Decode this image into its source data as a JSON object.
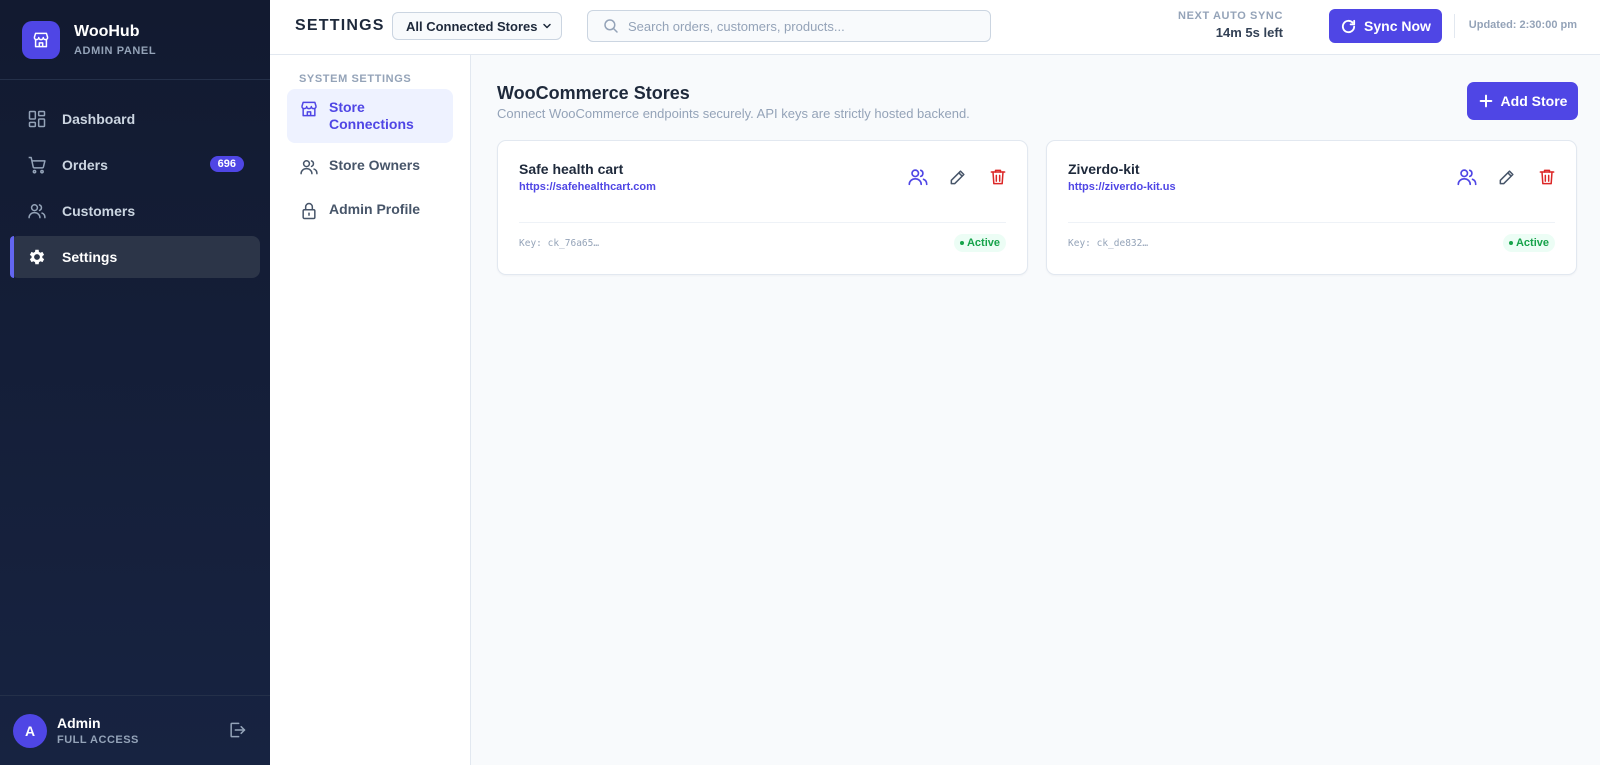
{
  "brand": {
    "name": "WooHub",
    "subtitle": "ADMIN PANEL",
    "logo_icon": "storefront-icon",
    "accent": "#4f46e5"
  },
  "nav": {
    "items": [
      {
        "label": "Dashboard",
        "icon": "dashboard-icon"
      },
      {
        "label": "Orders",
        "icon": "cart-icon",
        "badge": "696"
      },
      {
        "label": "Customers",
        "icon": "users-icon"
      },
      {
        "label": "Settings",
        "icon": "gear-icon",
        "active": true
      }
    ]
  },
  "user": {
    "initial": "A",
    "name": "Admin",
    "role": "FULL ACCESS"
  },
  "header": {
    "title": "SETTINGS",
    "store_select": "All Connected Stores",
    "search_placeholder": "Search orders, customers, products...",
    "sync_label": "NEXT AUTO SYNC",
    "sync_time": "14m 5s left",
    "sync_button": "Sync Now",
    "updated": "Updated: 2:30:00 pm"
  },
  "subnav": {
    "title": "SYSTEM SETTINGS",
    "items": [
      {
        "label": "Store Connections",
        "icon": "storefront-icon",
        "active": true
      },
      {
        "label": "Store Owners",
        "icon": "users-icon"
      },
      {
        "label": "Admin Profile",
        "icon": "lock-icon"
      }
    ]
  },
  "main": {
    "title": "WooCommerce Stores",
    "subtitle": "Connect WooCommerce endpoints securely. API keys are strictly hosted backend.",
    "add_button": "Add Store",
    "stores": [
      {
        "name": "Safe health cart",
        "url": "https://safehealthcart.com",
        "key": "Key: ck_76a65…",
        "status": "Active"
      },
      {
        "name": "Ziverdo-kit",
        "url": "https://ziverdo-kit.us",
        "key": "Key: ck_de832…",
        "status": "Active"
      }
    ]
  },
  "colors": {
    "sidebar": "#131c33",
    "danger": "#dc2626",
    "success": "#16a34a"
  }
}
